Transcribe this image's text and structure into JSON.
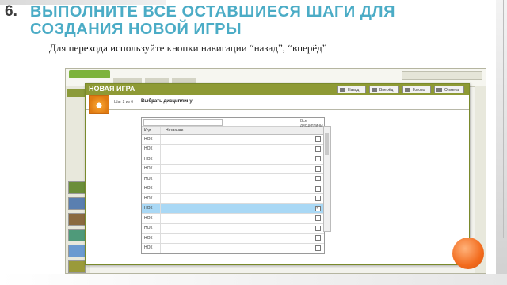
{
  "slide": {
    "number": "6.",
    "title": "Выполните все оставшиеся шаги для создания новой игры",
    "subtitle": "Для перехода используйте кнопки навигации “назад”, “вперёд”"
  },
  "dialog": {
    "title": "НОВАЯ ИГРА",
    "buttons": [
      "Назад",
      "Вперёд",
      "Готово",
      "Отмена"
    ],
    "step_label": "Шаг 2 из 6",
    "step_title": "Выбрать дисциплину",
    "search_placeholder": "",
    "filter_label": "Все дисциплины",
    "columns": [
      "Код",
      "Название"
    ],
    "rows": [
      {
        "code": "НОК",
        "name": "",
        "checked": false,
        "selected": false
      },
      {
        "code": "НОК",
        "name": "",
        "checked": false,
        "selected": false
      },
      {
        "code": "НОК",
        "name": "",
        "checked": false,
        "selected": false
      },
      {
        "code": "НОК",
        "name": "",
        "checked": false,
        "selected": false
      },
      {
        "code": "НОК",
        "name": "",
        "checked": false,
        "selected": false
      },
      {
        "code": "НОК",
        "name": "",
        "checked": false,
        "selected": false
      },
      {
        "code": "НОК",
        "name": "",
        "checked": false,
        "selected": false
      },
      {
        "code": "НОК",
        "name": "",
        "checked": true,
        "selected": true
      },
      {
        "code": "НОК",
        "name": "",
        "checked": false,
        "selected": false
      },
      {
        "code": "НОК",
        "name": "",
        "checked": false,
        "selected": false
      },
      {
        "code": "НОК",
        "name": "",
        "checked": false,
        "selected": false
      },
      {
        "code": "НОК",
        "name": "",
        "checked": false,
        "selected": false
      }
    ]
  },
  "colors": {
    "title": "#4bacc6",
    "dialog_header": "#8e9a35",
    "selected_row": "#a9d8f5",
    "accent_circle": "#f26b1d"
  }
}
